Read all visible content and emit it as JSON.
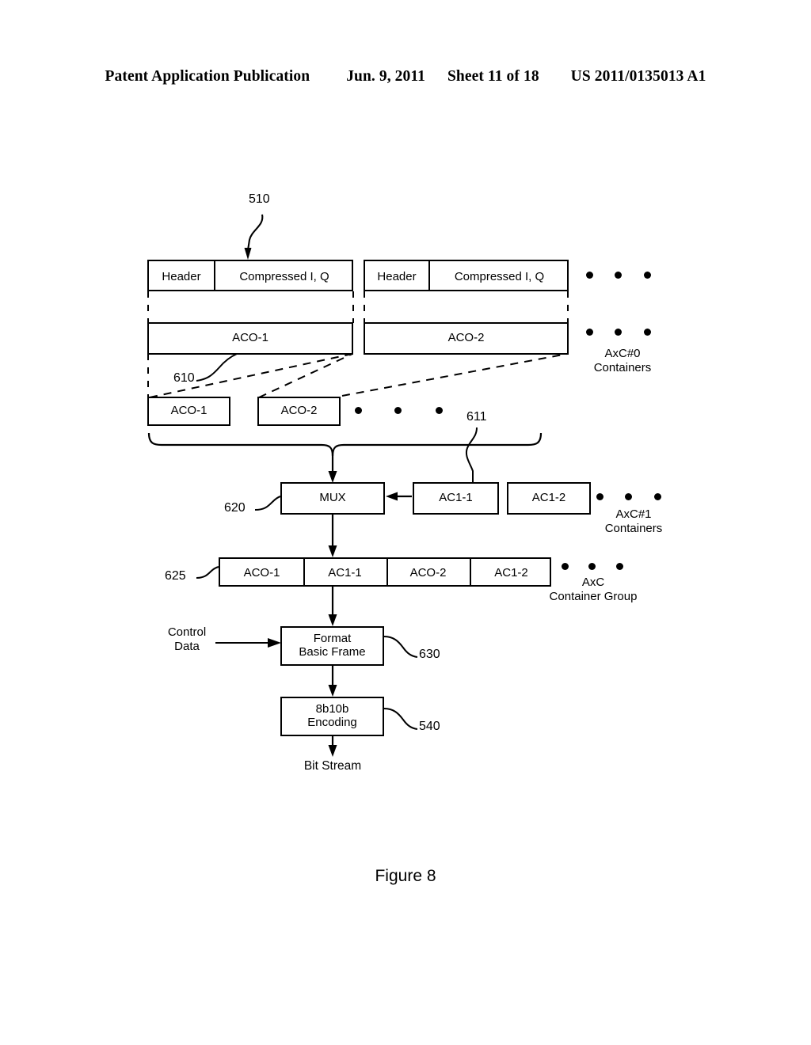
{
  "page": {
    "header": {
      "publication": "Patent Application Publication",
      "date": "Jun. 9, 2011",
      "sheet": "Sheet 11 of 18",
      "doc_number": "US 2011/0135013 A1"
    },
    "figure_caption": "Figure 8"
  },
  "diagram": {
    "packets": [
      {
        "header_label": "Header",
        "payload_label": "Compressed I, Q"
      },
      {
        "header_label": "Header",
        "payload_label": "Compressed I, Q"
      }
    ],
    "aco_frames": [
      {
        "label": "ACO-1"
      },
      {
        "label": "ACO-2"
      }
    ],
    "aco_containers": [
      {
        "label": "ACO-1"
      },
      {
        "label": "ACO-2"
      }
    ],
    "ac1_containers": [
      {
        "label": "AC1-1"
      },
      {
        "label": "AC1-2"
      }
    ],
    "mux": {
      "label": "MUX"
    },
    "container_group": {
      "cells": [
        "ACO-1",
        "AC1-1",
        "ACO-2",
        "AC1-2"
      ]
    },
    "format_block": {
      "line1": "Format",
      "line2": "Basic Frame"
    },
    "encoding_block": {
      "line1": "8b10b",
      "line2": "Encoding"
    },
    "control_input": {
      "line1": "Control",
      "line2": "Data"
    },
    "output": {
      "label": "Bit Stream"
    },
    "annotations": {
      "axc0_containers": {
        "line1": "AxC#0",
        "line2": "Containers"
      },
      "axc1_containers": {
        "line1": "AxC#1",
        "line2": "Containers"
      },
      "axc_group": {
        "line1": "AxC",
        "line2": "Container Group"
      }
    },
    "reference_numerals": {
      "n510": "510",
      "n610": "610",
      "n611": "611",
      "n620": "620",
      "n625": "625",
      "n630": "630",
      "n540": "540"
    }
  }
}
